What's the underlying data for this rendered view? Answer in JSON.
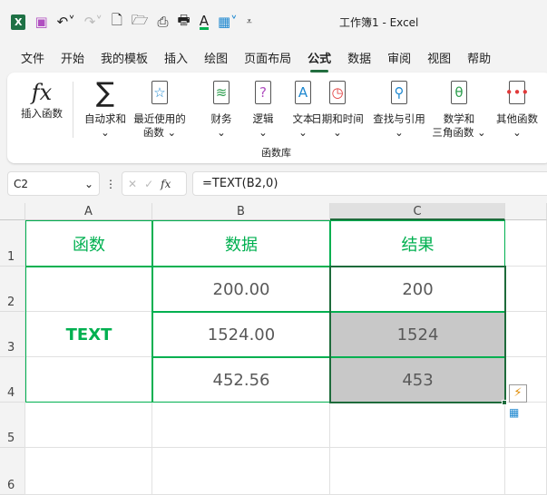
{
  "window": {
    "title": "工作簿1  -  Excel"
  },
  "quick_access": [
    "excel-logo-icon",
    "save-icon",
    "undo-icon",
    "redo-icon",
    "new-icon",
    "open-icon",
    "print-preview-icon",
    "print-icon",
    "font-color-icon",
    "borders-icon",
    "customize-icon"
  ],
  "tabs": [
    "文件",
    "开始",
    "我的模板",
    "插入",
    "绘图",
    "页面布局",
    "公式",
    "数据",
    "审阅",
    "视图",
    "帮助"
  ],
  "active_tab": "公式",
  "ribbon": {
    "insert_function": "插入函数",
    "insert_function_glyph": "fx",
    "buttons": [
      {
        "l1": "自动求和",
        "l2": "",
        "glyph": "∑",
        "color": "#333333"
      },
      {
        "l1": "最近使用的",
        "l2": "函数",
        "glyph": "☆",
        "color": "#1e88d0"
      },
      {
        "l1": "财务",
        "l2": "",
        "glyph": "≋",
        "color": "#2e9e4e"
      },
      {
        "l1": "逻辑",
        "l2": "",
        "glyph": "?",
        "color": "#b04fc0"
      },
      {
        "l1": "文本",
        "l2": "",
        "glyph": "A",
        "color": "#1e88d0"
      },
      {
        "l1": "日期和时间",
        "l2": "",
        "glyph": "◷",
        "color": "#e03a3a"
      },
      {
        "l1": "查找与引用",
        "l2": "",
        "glyph": "⚲",
        "color": "#1e88d0"
      },
      {
        "l1": "数学和",
        "l2": "三角函数",
        "glyph": "θ",
        "color": "#2e9e4e"
      },
      {
        "l1": "其他函数",
        "l2": "",
        "glyph": "•••",
        "color": "#e03a3a"
      }
    ],
    "group_label": "函数库"
  },
  "formula_bar": {
    "name_box": "C2",
    "formula": "=TEXT(B2,0)",
    "fx": "fx"
  },
  "columns": [
    "A",
    "B",
    "C"
  ],
  "rows": [
    "1",
    "2",
    "3",
    "4",
    "5",
    "6"
  ],
  "cells": {
    "A1": "函数",
    "B1": "数据",
    "C1": "结果",
    "A2": "TEXT",
    "B2": "200.00",
    "B3": "1524.00",
    "B4": "452.56",
    "C2": "200",
    "C3": "1524",
    "C4": "453"
  },
  "colors": {
    "green": "#00b050",
    "selection": "#1e6b3b",
    "fill": "#c8c8c8"
  }
}
